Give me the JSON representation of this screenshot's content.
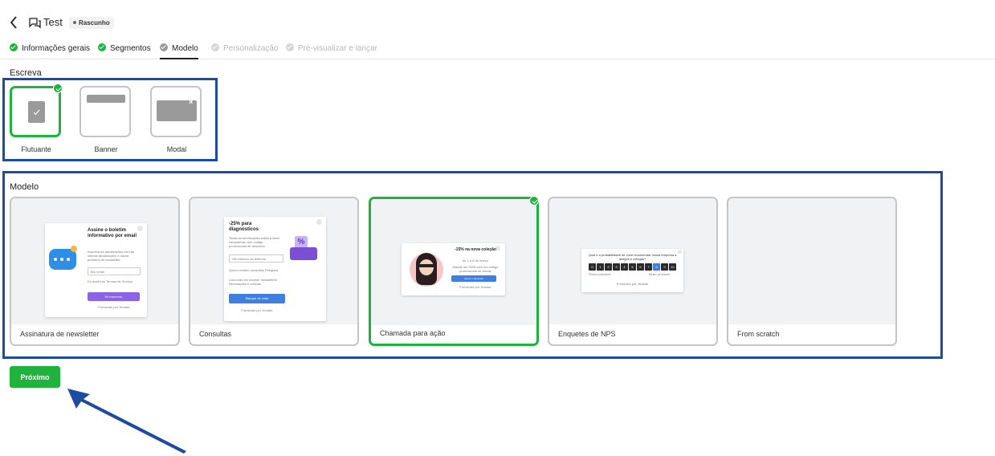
{
  "header": {
    "title": "Test",
    "badge": "Rascunho"
  },
  "steps": [
    {
      "label": "Informações gerais",
      "state": "done"
    },
    {
      "label": "Segmentos",
      "state": "done"
    },
    {
      "label": "Modelo",
      "state": "current"
    },
    {
      "label": "Personalização",
      "state": "disabled"
    },
    {
      "label": "Pré-visualizar e lançar",
      "state": "disabled"
    }
  ],
  "write": {
    "label": "Escreva",
    "types": [
      {
        "label": "Flutuante",
        "selected": true
      },
      {
        "label": "Banner",
        "selected": false
      },
      {
        "label": "Modal",
        "selected": false
      }
    ]
  },
  "model": {
    "label": "Modelo",
    "templates": [
      {
        "label": "Assinatura de newsletter",
        "selected": false,
        "preview": {
          "title": "Assine o boletim informativo por email",
          "body": "Inscreva-se atualizações com as últimas atualizações e novos produtos de newsletter.",
          "input": "Seu email",
          "consent": "Eu aceito os Termos de Serviço",
          "button": "Se inscrever",
          "footer": "Fornecido por Jivosite"
        }
      },
      {
        "label": "Consultas",
        "selected": false,
        "preview": {
          "title": "-25% para diagnósticos",
          "body": "Todas as informações estão a fazer campanhas com código promocional de desconto",
          "input_prefix": "+55",
          "input": "Número de telefone",
          "option1": "Quero receber consultas Pesquisa",
          "option2": "Concordo em receber newsletters informações e notícias",
          "button": "Marque de volta",
          "footer": "Fornecido por Jivosite"
        }
      },
      {
        "label": "Chamada para ação",
        "selected": true,
        "preview": {
          "title": "-15% na nova coleção",
          "subtitle": "de 1 a 8 de março",
          "body": "Mande um SMS com um código promocional de brinde",
          "button": "Quero o desconto",
          "footer": "Fornecido por Jivosite"
        }
      },
      {
        "label": "Enquetes de NPS",
        "selected": false,
        "preview": {
          "title": "Qual é a probabilidade de você recomendar nossa empresa a amigos e colegas?",
          "scale": [
            "0",
            "1",
            "2",
            "3",
            "4",
            "5",
            "6",
            "7",
            "8",
            "9",
            "10"
          ],
          "low": "Pouco provável",
          "high": "Muito provável",
          "footer": "Fornecido por Jivosite"
        }
      },
      {
        "label": "From scratch",
        "selected": false
      }
    ]
  },
  "actions": {
    "next": "Próximo"
  },
  "colors": {
    "green": "#1fb23d",
    "annotation_blue": "#1d4ba0",
    "button_blue": "#3f7fe0",
    "purple": "#8a63e6"
  }
}
